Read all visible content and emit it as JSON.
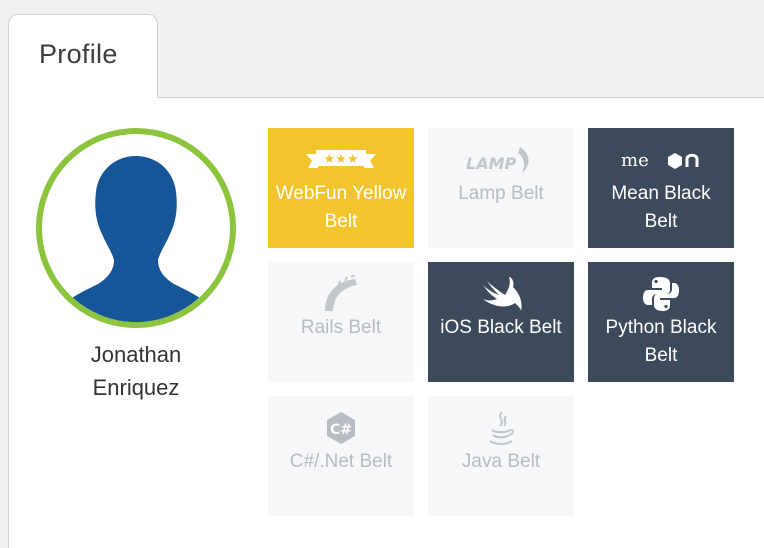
{
  "tabs": [
    {
      "label": "Profile"
    }
  ],
  "user": {
    "name_line1": "Jonathan",
    "name_line2": "Enriquez"
  },
  "belts": [
    {
      "label": "WebFun Yellow Belt",
      "icon": "webfun-icon",
      "state": "earned",
      "color": "#f2c52e"
    },
    {
      "label": "Lamp Belt",
      "icon": "lamp-icon",
      "state": "not-earned"
    },
    {
      "label": "Mean Black Belt",
      "icon": "mean-icon",
      "state": "earned",
      "color": "#3d4a5b"
    },
    {
      "label": "Rails Belt",
      "icon": "rails-icon",
      "state": "not-earned"
    },
    {
      "label": "iOS Black Belt",
      "icon": "swift-icon",
      "state": "earned",
      "color": "#3d4a5b"
    },
    {
      "label": "Python Black Belt",
      "icon": "python-icon",
      "state": "earned",
      "color": "#3d4a5b"
    },
    {
      "label": "C#/.Net Belt",
      "icon": "csharp-icon",
      "state": "not-earned"
    },
    {
      "label": "Java Belt",
      "icon": "java-icon",
      "state": "not-earned"
    }
  ],
  "colors": {
    "avatar_ring": "#8cc43d",
    "avatar_silhouette": "#165597",
    "page_bg": "#eef0f2"
  }
}
